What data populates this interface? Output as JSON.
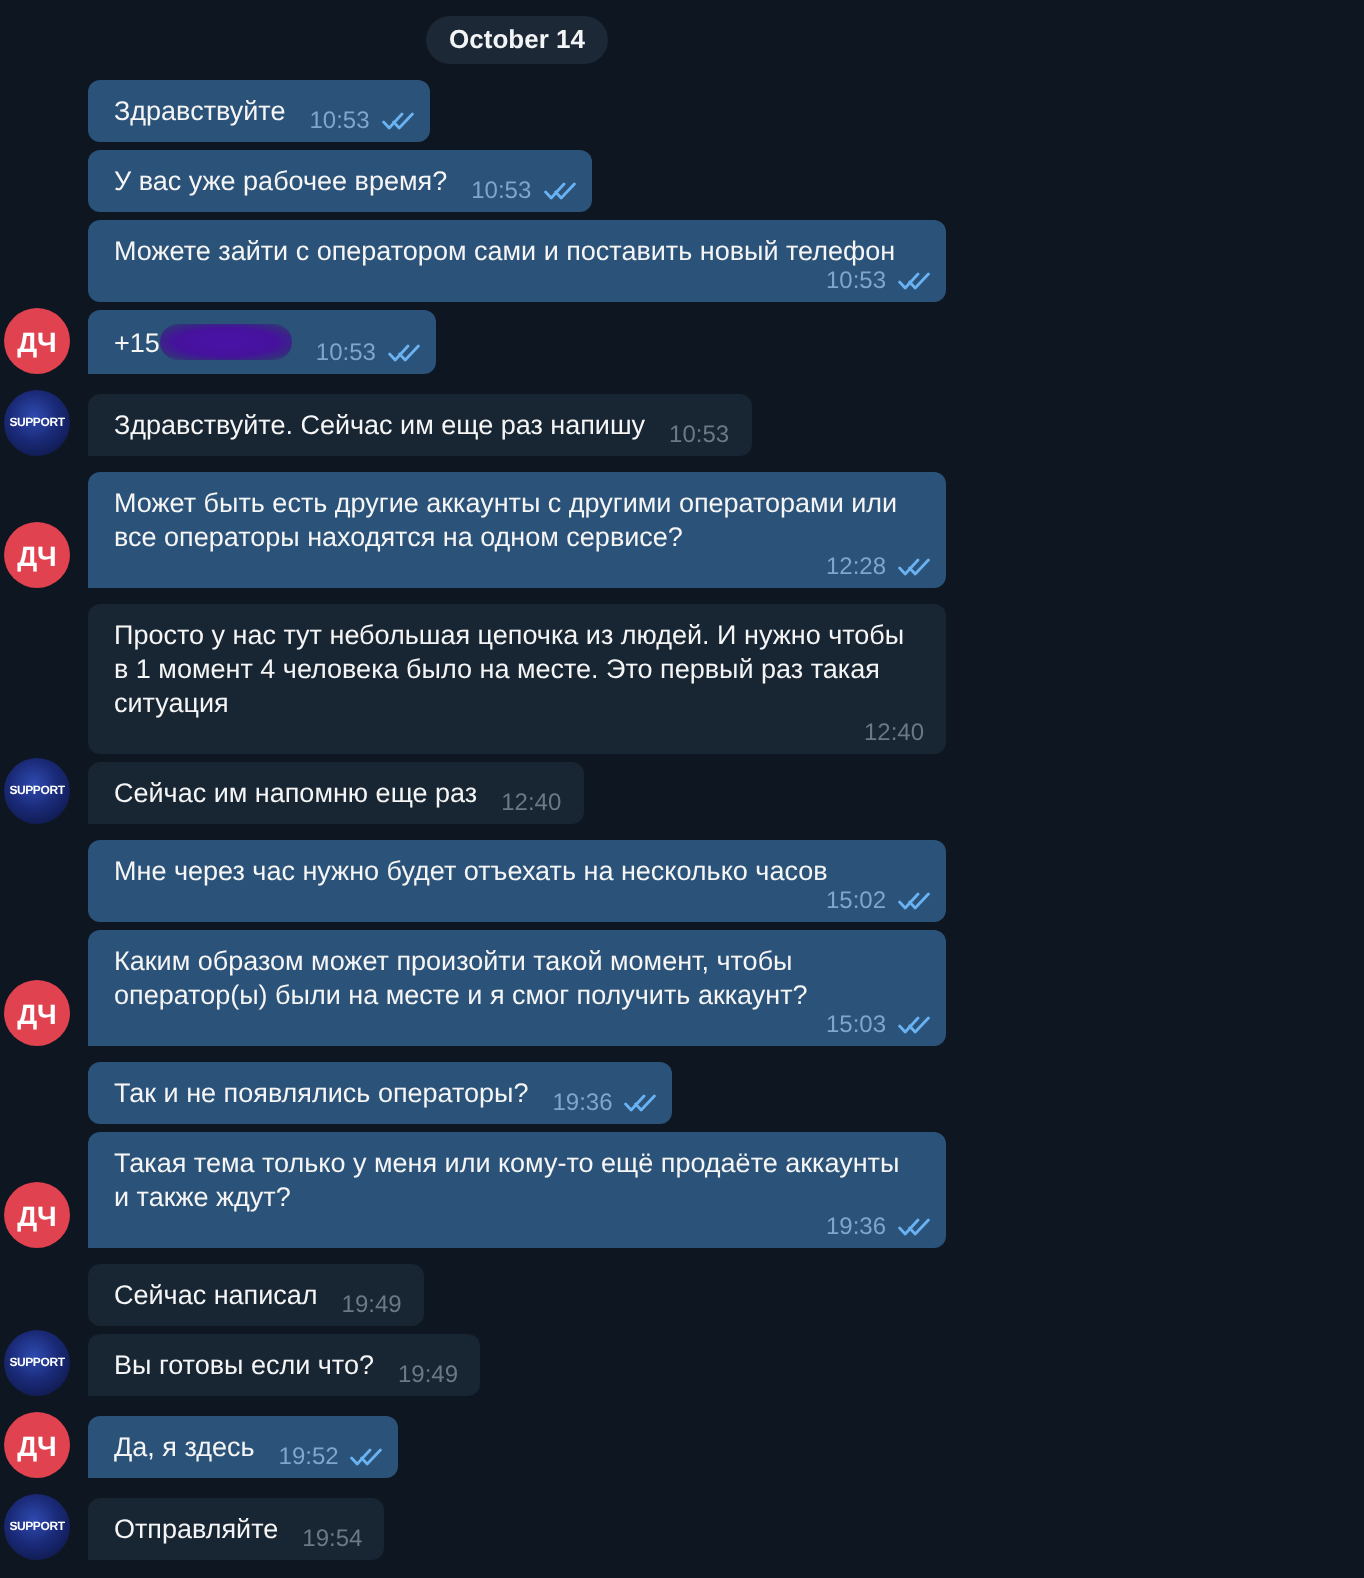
{
  "date_badge": "October 14",
  "groups": [
    {
      "kind": "customer",
      "avatar": "ДЧ",
      "messages": [
        {
          "text": "Здравствуйте",
          "time": "10:53",
          "read": true
        },
        {
          "text": "У вас уже рабочее время?",
          "time": "10:53",
          "read": true
        },
        {
          "text": "Можете зайти с оператором сами и поставить новый телефон",
          "time": "10:53",
          "read": true
        },
        {
          "text": "+15",
          "redacted": true,
          "time": "10:53",
          "read": true
        }
      ]
    },
    {
      "kind": "support",
      "avatar": "SUPPORT",
      "messages": [
        {
          "text": "Здравствуйте. Сейчас им еще раз напишу",
          "time": "10:53"
        }
      ]
    },
    {
      "kind": "customer",
      "avatar": "ДЧ",
      "messages": [
        {
          "text": "Может быть есть другие аккаунты с другими операторами или все операторы находятся на одном сервисе?",
          "time": "12:28",
          "read": true
        }
      ]
    },
    {
      "kind": "support",
      "avatar": "SUPPORT",
      "messages": [
        {
          "text": "Просто у нас тут небольшая цепочка из людей. И нужно чтобы в 1 момент 4 человека было на месте. Это первый раз такая ситуация",
          "time": "12:40"
        },
        {
          "text": "Сейчас им напомню еще раз",
          "time": "12:40"
        }
      ]
    },
    {
      "kind": "customer",
      "avatar": "ДЧ",
      "messages": [
        {
          "text": "Мне через час нужно будет отъехать на несколько часов",
          "time": "15:02",
          "read": true
        },
        {
          "text": "Каким образом может произойти такой момент, чтобы оператор(ы) были на месте и я смог получить аккаунт?",
          "time": "15:03",
          "read": true
        }
      ]
    },
    {
      "kind": "customer",
      "avatar": "ДЧ",
      "messages": [
        {
          "text": "Так и не появлялись операторы?",
          "time": "19:36",
          "read": true
        },
        {
          "text": "Такая тема только у меня или кому-то ещё продаёте аккаунты и также ждут?",
          "time": "19:36",
          "read": true
        }
      ]
    },
    {
      "kind": "support",
      "avatar": "SUPPORT",
      "messages": [
        {
          "text": "Сейчас написал",
          "time": "19:49"
        },
        {
          "text": "Вы готовы если что?",
          "time": "19:49"
        }
      ]
    },
    {
      "kind": "customer",
      "avatar": "ДЧ",
      "messages": [
        {
          "text": "Да, я здесь",
          "time": "19:52",
          "read": true
        }
      ]
    },
    {
      "kind": "support",
      "avatar": "SUPPORT",
      "messages": [
        {
          "text": "Отправляйте",
          "time": "19:54"
        }
      ]
    }
  ]
}
